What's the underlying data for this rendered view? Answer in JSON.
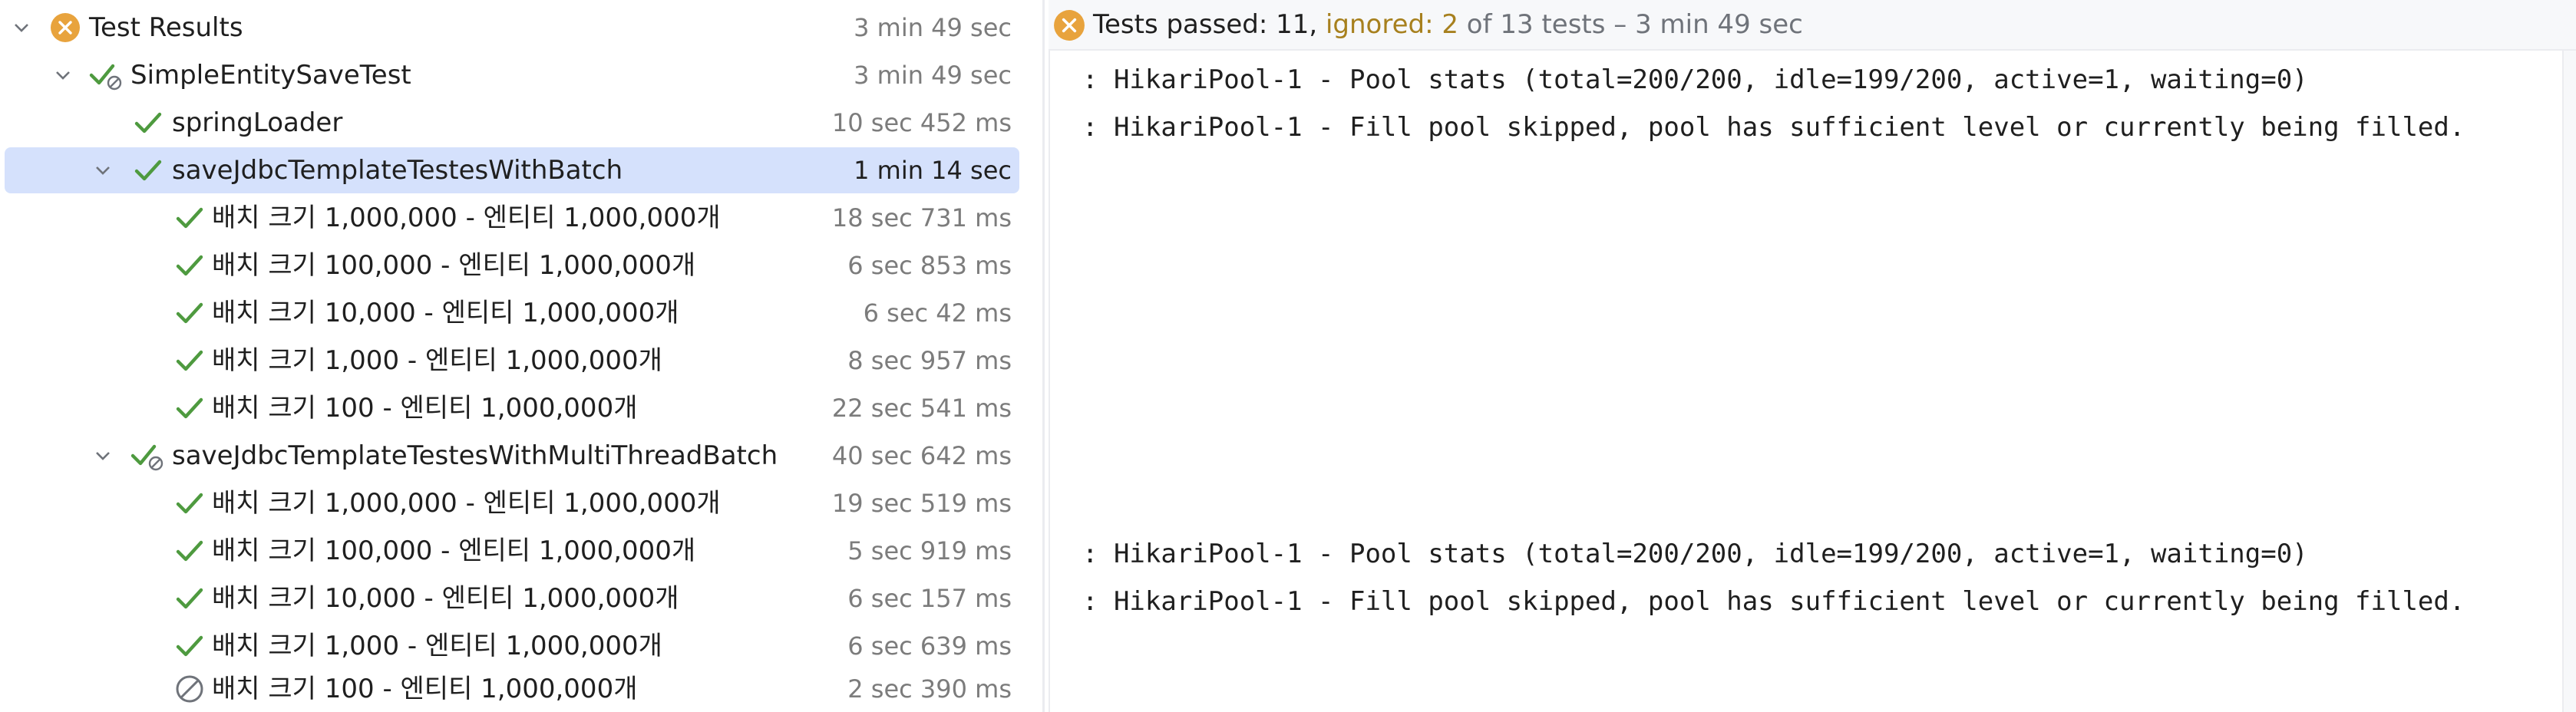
{
  "tree": {
    "rows": [
      {
        "label": "Test Results",
        "time": "3 min 49 sec",
        "status": "warning"
      },
      {
        "label": "SimpleEntitySaveTest",
        "time": "3 min 49 sec",
        "status": "passed-ignored"
      },
      {
        "label": "springLoader",
        "time": "10 sec 452 ms",
        "status": "passed"
      },
      {
        "label": "saveJdbcTemplateTestesWithBatch",
        "time": "1 min 14 sec",
        "status": "passed"
      },
      {
        "label": "배치 크기 1,000,000 - 엔티티 1,000,000개",
        "time": "18 sec 731 ms",
        "status": "passed"
      },
      {
        "label": "배치 크기 100,000 - 엔티티 1,000,000개",
        "time": "6 sec 853 ms",
        "status": "passed"
      },
      {
        "label": "배치 크기 10,000 - 엔티티 1,000,000개",
        "time": "6 sec 42 ms",
        "status": "passed"
      },
      {
        "label": "배치 크기 1,000 - 엔티티 1,000,000개",
        "time": "8 sec 957 ms",
        "status": "passed"
      },
      {
        "label": "배치 크기 100 - 엔티티 1,000,000개",
        "time": "22 sec 541 ms",
        "status": "passed"
      },
      {
        "label": "saveJdbcTemplateTestesWithMultiThreadBatch",
        "time": "40 sec 642 ms",
        "status": "passed-ignored"
      },
      {
        "label": "배치 크기 1,000,000 - 엔티티 1,000,000개",
        "time": "19 sec 519 ms",
        "status": "passed"
      },
      {
        "label": "배치 크기 100,000 - 엔티티 1,000,000개",
        "time": "5 sec 919 ms",
        "status": "passed"
      },
      {
        "label": "배치 크기 10,000 - 엔티티 1,000,000개",
        "time": "6 sec 157 ms",
        "status": "passed"
      },
      {
        "label": "배치 크기 1,000 - 엔티티 1,000,000개",
        "time": "6 sec 639 ms",
        "status": "passed"
      },
      {
        "label": "배치 크기 100 - 엔티티 1,000,000개",
        "time": "2 sec 390 ms",
        "status": "ignored"
      }
    ]
  },
  "status": {
    "passed": "Tests passed: 11,",
    "ignored": "ignored: 2",
    "rest": "of 13 tests – 3 min 49 sec"
  },
  "log": {
    "lines": [
      ": HikariPool-1 - Pool stats (total=200/200, idle=199/200, active=1, waiting=0)",
      ": HikariPool-1 - Fill pool skipped, pool has sufficient level or currently being filled.",
      ": HikariPool-1 - Pool stats (total=200/200, idle=199/200, active=1, waiting=0)",
      ": HikariPool-1 - Fill pool skipped, pool has sufficient level or currently being filled."
    ]
  },
  "colors": {
    "check": "#4e9a3f",
    "warning": "#e8a33d",
    "selection": "#d5e1fc",
    "ignored_text": "#a7801e"
  }
}
